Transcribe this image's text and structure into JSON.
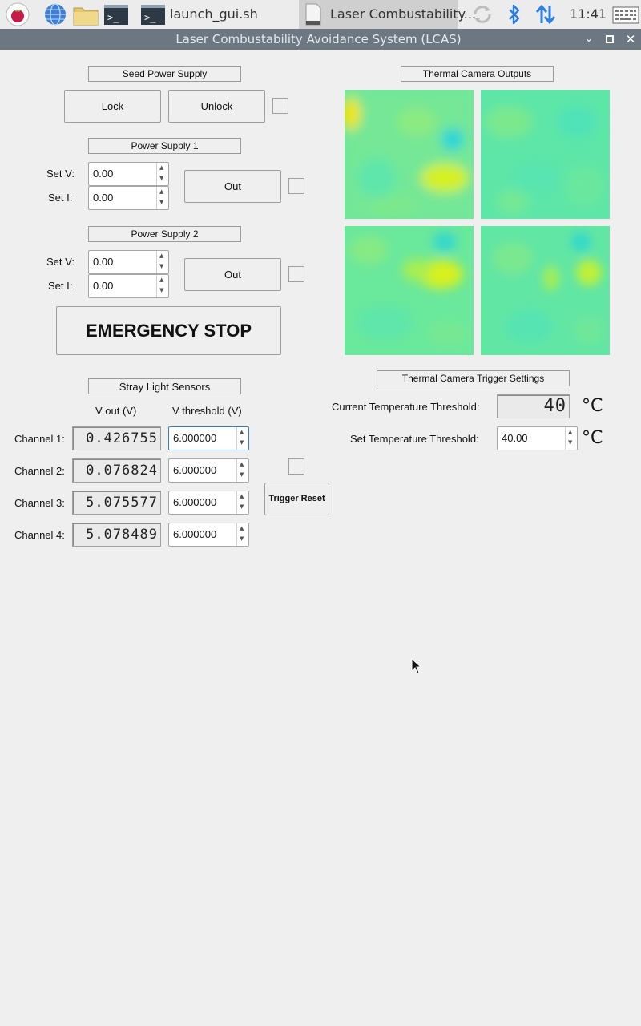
{
  "taskbar": {
    "task1_label": "launch_gui.sh",
    "task2_label": "Laser Combustability...",
    "clock": "11:41"
  },
  "window": {
    "title": "Laser Combustability Avoidance System (LCAS)"
  },
  "seed": {
    "title": "Seed Power Supply",
    "lock_label": "Lock",
    "unlock_label": "Unlock"
  },
  "ps1": {
    "title": "Power Supply 1",
    "set_v_label": "Set V:",
    "set_v": "0.00",
    "set_i_label": "Set I:",
    "set_i": "0.00",
    "out_label": "Out"
  },
  "ps2": {
    "title": "Power Supply 2",
    "set_v_label": "Set V:",
    "set_v": "0.00",
    "set_i_label": "Set I:",
    "set_i": "0.00",
    "out_label": "Out"
  },
  "estop_label": "EMERGENCY STOP",
  "stray": {
    "title": "Stray Light Sensors",
    "col_vout": "V out (V)",
    "col_vth": "V threshold (V)",
    "channels": [
      {
        "label": "Channel 1:",
        "vout": "0.426755",
        "vth": "6.000000"
      },
      {
        "label": "Channel 2:",
        "vout": "0.076824",
        "vth": "6.000000"
      },
      {
        "label": "Channel 3:",
        "vout": "5.075577",
        "vth": "6.000000"
      },
      {
        "label": "Channel 4:",
        "vout": "5.078489",
        "vth": "6.000000"
      }
    ],
    "trigger_reset_label": "Trigger Reset"
  },
  "thermal": {
    "outputs_title": "Thermal Camera Outputs",
    "trigger_title": "Thermal Camera Trigger Settings",
    "current_label": "Current Temperature Threshold:",
    "current_value": "40",
    "set_label": "Set Temperature Threshold:",
    "set_value": "40.00",
    "unit": "°C",
    "colors": {
      "base": "#5ee8a0",
      "hot": "#e9f20f",
      "cool": "#29d9d9"
    }
  }
}
